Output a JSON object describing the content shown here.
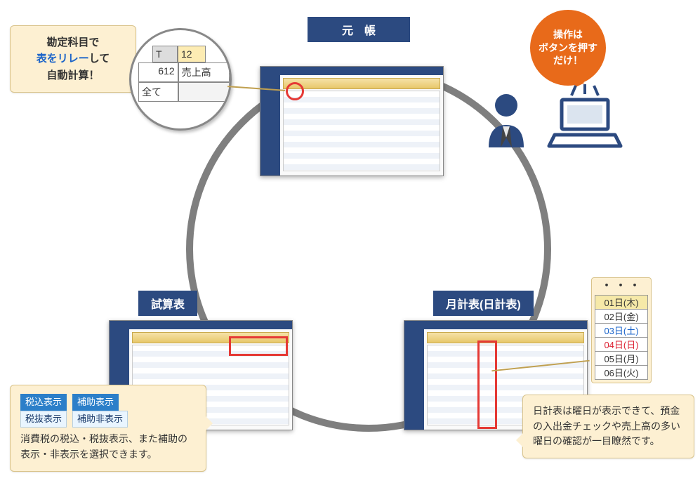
{
  "labels": {
    "top": "元　帳",
    "left": "試算表",
    "right": "月計表(日計表)"
  },
  "speech": {
    "line1": "操作は",
    "line2": "ボタンを押す",
    "line3": "だけ！"
  },
  "callout_tl": {
    "line1": "勘定科目で",
    "relay_prefix": "表をリレー",
    "relay_suffix": "して",
    "line3": "自動計算！"
  },
  "zoom": {
    "t1": "T",
    "t2": "12",
    "code": "612",
    "name": "売上高",
    "all": "全て"
  },
  "callout_bl": {
    "tags": {
      "tax_incl": "税込表示",
      "tax_excl": "税抜表示",
      "sub_show": "補助表示",
      "sub_hide": "補助非表示"
    },
    "text": "消費税の税込・税抜表示、また補助の表示・非表示を選択できます。"
  },
  "callout_br": {
    "text": "日計表は曜日が表示できて、預金の入出金チェックや売上高の多い曜日の確認が一目瞭然です。"
  },
  "daylist": {
    "dots": "・・・",
    "rows": [
      {
        "t": "01日(木)",
        "cls": "sel"
      },
      {
        "t": "02日(金)",
        "cls": ""
      },
      {
        "t": "03日(土)",
        "cls": "sat"
      },
      {
        "t": "04日(日)",
        "cls": "sun"
      },
      {
        "t": "05日(月)",
        "cls": ""
      },
      {
        "t": "06日(火)",
        "cls": ""
      }
    ]
  }
}
